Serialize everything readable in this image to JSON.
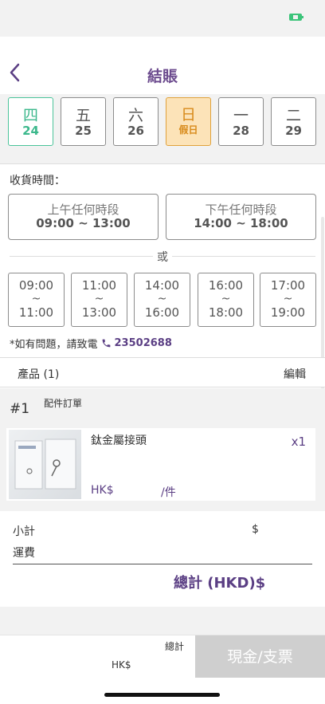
{
  "colors": {
    "accent_purple": "#5b3f84",
    "selected_green": "#3cb88c",
    "holiday_orange": "#d88a1a",
    "holiday_bg": "#fce3b8",
    "pay_button_disabled": "#cfcfcf"
  },
  "status_bar": {
    "battery_icon": "battery-icon"
  },
  "nav": {
    "title": "結賬",
    "back_icon": "chevron-left-icon"
  },
  "dates": [
    {
      "weekday": "四",
      "sub": "24",
      "state": "selected"
    },
    {
      "weekday": "五",
      "sub": "25",
      "state": "normal"
    },
    {
      "weekday": "六",
      "sub": "26",
      "state": "normal"
    },
    {
      "weekday": "日",
      "sub": "假日",
      "state": "holiday"
    },
    {
      "weekday": "一",
      "sub": "28",
      "state": "normal"
    },
    {
      "weekday": "二",
      "sub": "29",
      "state": "normal"
    }
  ],
  "delivery": {
    "label": "收貨時間：",
    "periods": [
      {
        "label": "上午任何時段",
        "time": "09:00 ~ 13:00"
      },
      {
        "label": "下午任何時段",
        "time": "14:00 ~ 18:00"
      }
    ],
    "or_text": "或",
    "slots": [
      {
        "start": "09:00",
        "sep": "~",
        "end": "11:00"
      },
      {
        "start": "11:00",
        "sep": "~",
        "end": "13:00"
      },
      {
        "start": "14:00",
        "sep": "~",
        "end": "16:00"
      },
      {
        "start": "16:00",
        "sep": "~",
        "end": "18:00"
      },
      {
        "start": "17:00",
        "sep": "~",
        "end": "19:00"
      }
    ],
    "help_text": "*如有問題，請致電",
    "phone": "23502688"
  },
  "products": {
    "label": "產品 (1)",
    "edit": "編輯",
    "order_number": "#1",
    "order_type": "配件訂單",
    "item": {
      "name": "鈦金屬接頭",
      "qty": "x1",
      "price": "HK$",
      "unit": "/件"
    }
  },
  "summary": {
    "subtotal_label": "小計",
    "subtotal_value": "$",
    "shipping_label": "運費",
    "total_label": "總計 (HKD)$"
  },
  "footer": {
    "total_label": "總計",
    "total_value": "HK$",
    "pay_button": "現金/支票"
  }
}
